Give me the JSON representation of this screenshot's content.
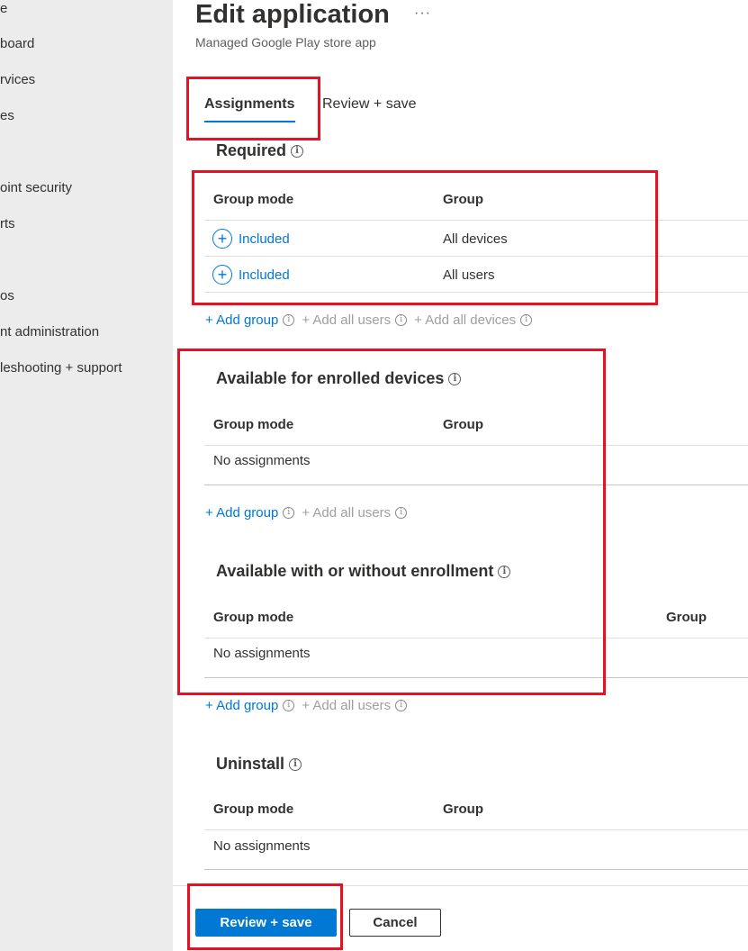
{
  "sidebar": {
    "items": [
      {
        "label": "e"
      },
      {
        "label": "board"
      },
      {
        "label": "rvices"
      },
      {
        "label": "es"
      },
      {
        "label": "oint security"
      },
      {
        "label": "rts"
      },
      {
        "label": "os"
      },
      {
        "label": "nt administration"
      },
      {
        "label": "leshooting + support"
      }
    ]
  },
  "header": {
    "title": "Edit application",
    "more_icon": "···",
    "subtitle": "Managed Google Play store app"
  },
  "tabs": [
    {
      "label": "Assignments",
      "active": true
    },
    {
      "label": "Review + save",
      "active": false
    }
  ],
  "sections": {
    "required": {
      "title": "Required",
      "columns": [
        "Group mode",
        "Group"
      ],
      "rows": [
        {
          "mode": "Included",
          "group": "All devices"
        },
        {
          "mode": "Included",
          "group": "All users"
        }
      ],
      "actions": [
        "+ Add group",
        "+ Add all users",
        "+ Add all devices"
      ]
    },
    "available_enrolled": {
      "title": "Available for enrolled devices",
      "columns": [
        "Group mode",
        "Group"
      ],
      "empty": "No assignments",
      "actions": [
        "+ Add group",
        "+ Add all users"
      ]
    },
    "available_any": {
      "title": "Available with or without enrollment",
      "columns": [
        "Group mode",
        "Group"
      ],
      "empty": "No assignments",
      "actions": [
        "+ Add group",
        "+ Add all users"
      ]
    },
    "uninstall": {
      "title": "Uninstall",
      "columns": [
        "Group mode",
        "Group"
      ],
      "empty": "No assignments"
    }
  },
  "footer": {
    "primary": "Review + save",
    "secondary": "Cancel"
  },
  "icons": {
    "info": "i",
    "plus": "+"
  },
  "colors": {
    "accent": "#0078d4",
    "highlight": "#e81123",
    "sidebar_bg": "#ececec"
  }
}
